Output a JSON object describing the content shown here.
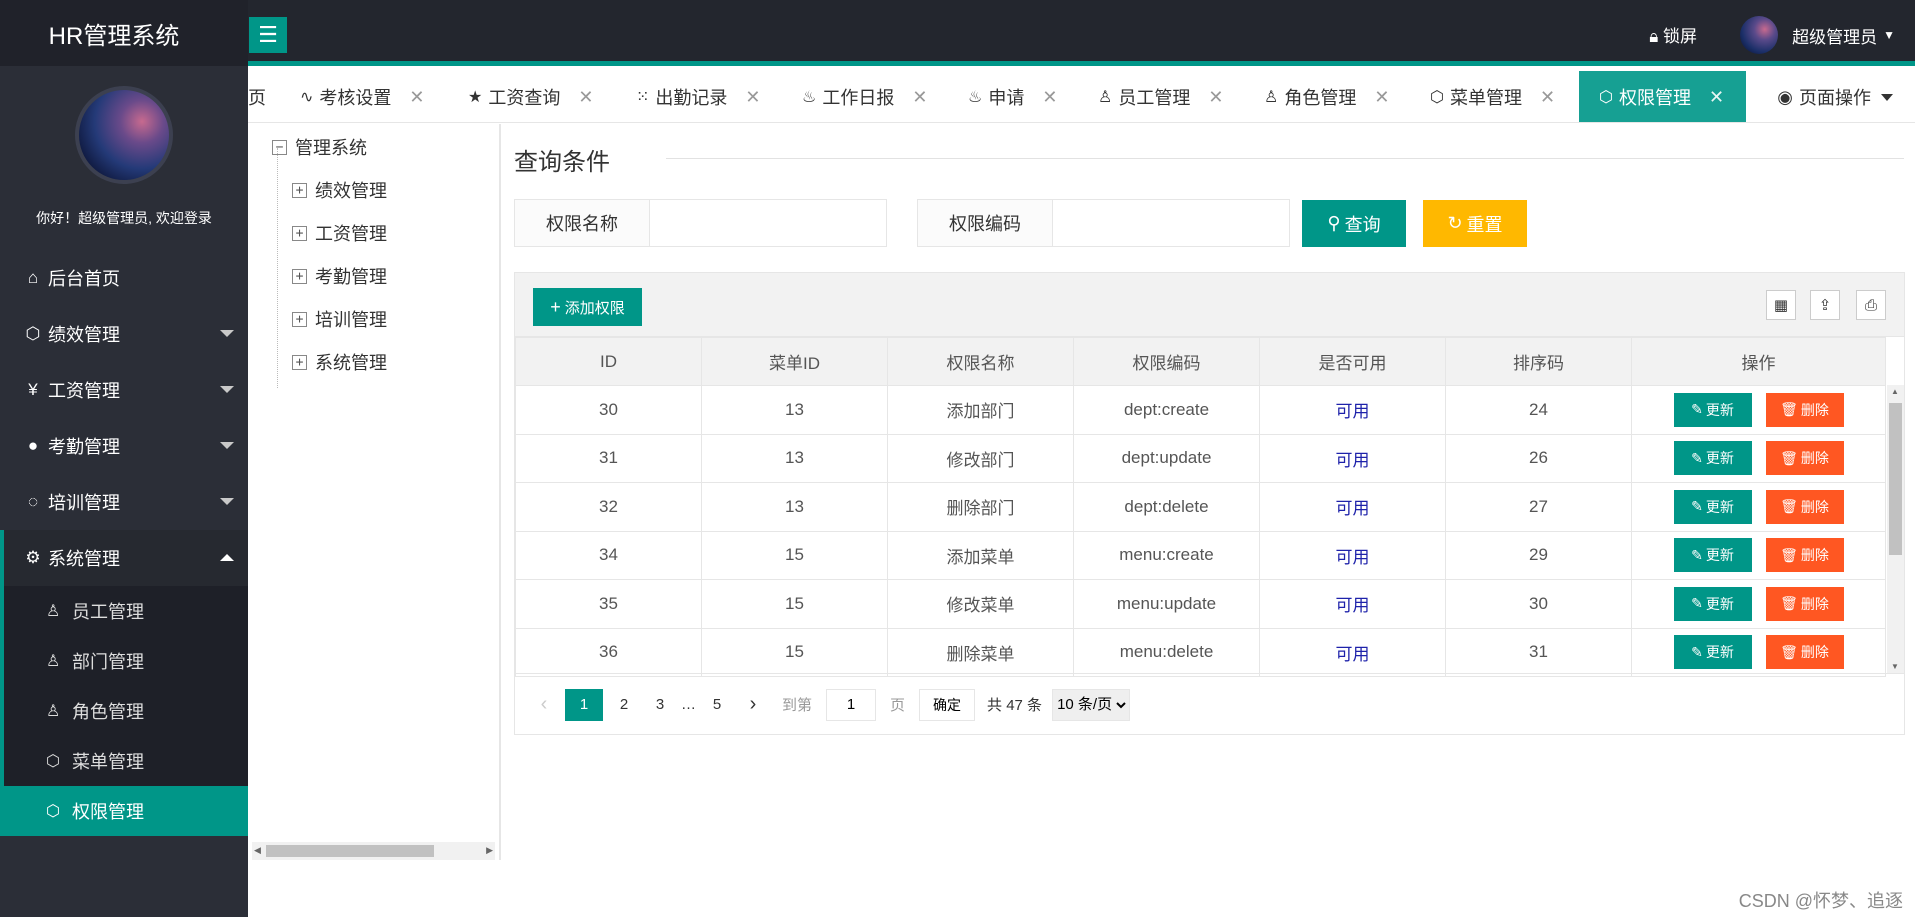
{
  "app_title": "HR管理系统",
  "header": {
    "menu_icon": "hamburger-icon",
    "lock_label": "锁屏",
    "user_name": "超级管理员"
  },
  "sidebar": {
    "welcome": "你好！超级管理员, 欢迎登录",
    "items": [
      {
        "label": "后台首页",
        "icon": "home-icon"
      },
      {
        "label": "绩效管理",
        "icon": "cube-icon"
      },
      {
        "label": "工资管理",
        "icon": "yen-icon"
      },
      {
        "label": "考勤管理",
        "icon": "chat-icon"
      },
      {
        "label": "培训管理",
        "icon": "dashed-circle-icon"
      },
      {
        "label": "系统管理",
        "icon": "gear-icon"
      }
    ],
    "subitems": [
      {
        "label": "员工管理",
        "icon": "user-icon"
      },
      {
        "label": "部门管理",
        "icon": "user-icon"
      },
      {
        "label": "角色管理",
        "icon": "user-icon"
      },
      {
        "label": "菜单管理",
        "icon": "cube-icon"
      },
      {
        "label": "权限管理",
        "icon": "cube-icon"
      }
    ]
  },
  "tabs": [
    {
      "label": "页"
    },
    {
      "label": "考核设置"
    },
    {
      "label": "工资查询"
    },
    {
      "label": "出勤记录"
    },
    {
      "label": "工作日报"
    },
    {
      "label": "申请"
    },
    {
      "label": "员工管理"
    },
    {
      "label": "角色管理"
    },
    {
      "label": "菜单管理"
    },
    {
      "label": "权限管理"
    }
  ],
  "page_op": "页面操作",
  "tree": {
    "root": "管理系统",
    "children": [
      "绩效管理",
      "工资管理",
      "考勤管理",
      "培训管理",
      "系统管理"
    ]
  },
  "query": {
    "title": "查询条件",
    "name_label": "权限名称",
    "name_value": "",
    "code_label": "权限编码",
    "code_value": "",
    "search_button": "查询",
    "reset_button": "重置"
  },
  "table": {
    "add_button": "添加权限",
    "columns": [
      "ID",
      "菜单ID",
      "权限名称",
      "权限编码",
      "是否可用",
      "排序码",
      "操作"
    ],
    "rows": [
      [
        "30",
        "13",
        "添加部门",
        "dept:create",
        "可用",
        "24"
      ],
      [
        "31",
        "13",
        "修改部门",
        "dept:update",
        "可用",
        "26"
      ],
      [
        "32",
        "13",
        "删除部门",
        "dept:delete",
        "可用",
        "27"
      ],
      [
        "34",
        "15",
        "添加菜单",
        "menu:create",
        "可用",
        "29"
      ],
      [
        "35",
        "15",
        "修改菜单",
        "menu:update",
        "可用",
        "30"
      ],
      [
        "36",
        "15",
        "删除菜单",
        "menu:delete",
        "可用",
        "31"
      ]
    ],
    "update_label": "更新",
    "delete_label": "删除"
  },
  "pager": {
    "pages": [
      "1",
      "2",
      "3",
      "…",
      "5"
    ],
    "goto_label": "到第",
    "goto_value": "1",
    "page_unit": "页",
    "confirm": "确定",
    "total": "共 47 条",
    "page_size": "10 条/页"
  },
  "watermark": "CSDN @怀梦、追逐",
  "colors": {
    "accent": "#009688",
    "warning": "#ffb800",
    "danger": "#ff5722",
    "sidebar": "#2b2e37"
  }
}
